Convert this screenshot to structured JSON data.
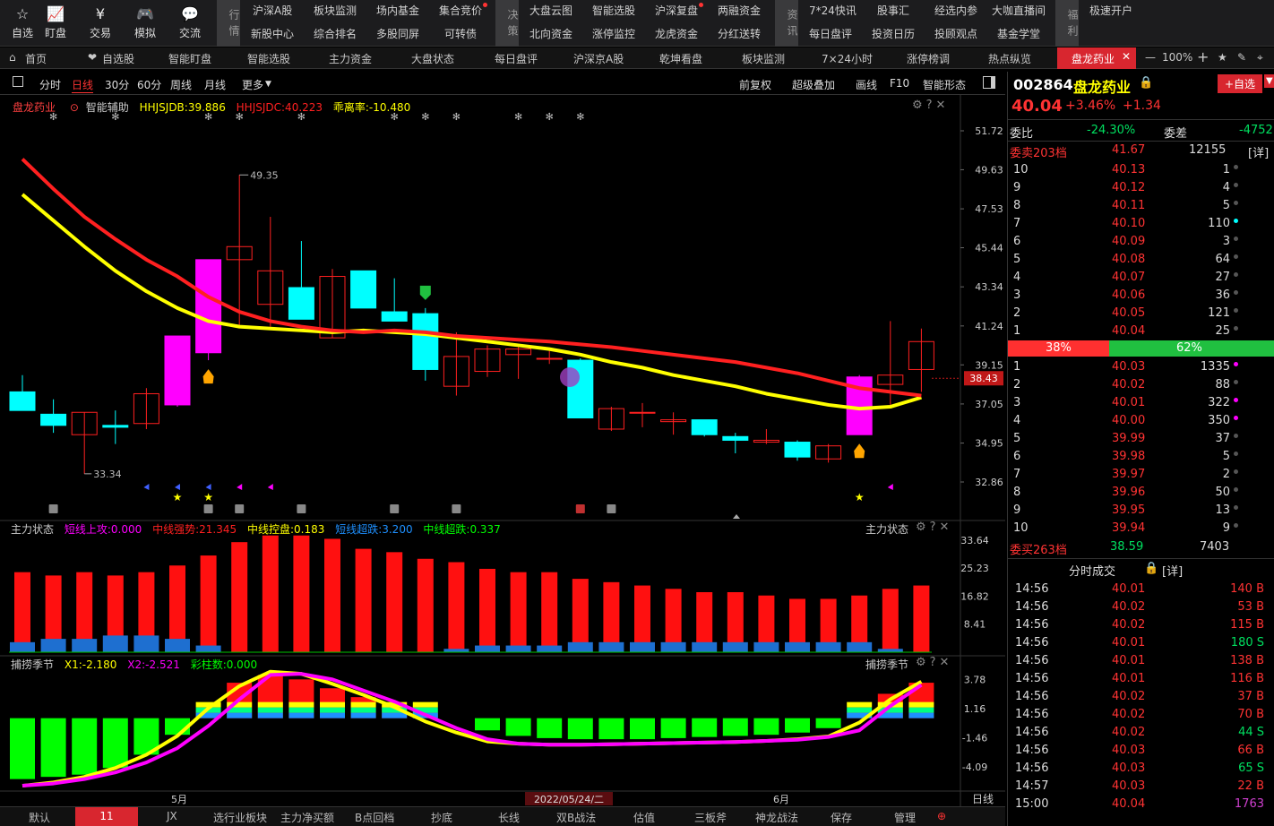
{
  "topbar": {
    "buttons": [
      {
        "label": "自选",
        "icon": "star-icon"
      },
      {
        "label": "盯盘",
        "icon": "chart-icon"
      },
      {
        "label": "交易",
        "icon": "yen-icon"
      },
      {
        "label": "模拟",
        "icon": "gamepad-icon"
      },
      {
        "label": "交流",
        "icon": "chat-icon"
      }
    ],
    "groups": [
      {
        "tab": "行情",
        "items": [
          [
            "沪深A股",
            "新股中心"
          ],
          [
            "板块监测",
            "综合排名"
          ],
          [
            "场内基金",
            "多股同屏"
          ],
          [
            "集合竞价",
            "可转债"
          ]
        ]
      },
      {
        "tab": "决策",
        "items": [
          [
            "大盘云图",
            "北向资金"
          ],
          [
            "智能选股",
            "涨停监控"
          ],
          [
            "沪深复盘",
            "龙虎资金"
          ],
          [
            "两融资金",
            "分红送转"
          ]
        ]
      },
      {
        "tab": "资讯",
        "items": [
          [
            "7*24快讯",
            "每日盘评"
          ],
          [
            "股事汇",
            "投资日历"
          ],
          [
            "经选内参",
            "投顾观点"
          ],
          [
            "大咖直播间",
            "基金学堂"
          ]
        ]
      },
      {
        "tab": "福利",
        "items": [
          [
            "极速开户",
            ""
          ]
        ]
      }
    ]
  },
  "nav": {
    "items": [
      "首页",
      "自选股",
      "智能盯盘",
      "智能选股",
      "主力资金",
      "大盘状态",
      "每日盘评",
      "沪深京A股",
      "乾坤看盘",
      "板块监测",
      "7×24小时",
      "涨停榜调",
      "热点纵览"
    ],
    "active": "盘龙药业",
    "zoom": "100%"
  },
  "period": {
    "items": [
      "分时",
      "日线",
      "30分",
      "60分",
      "周线",
      "月线",
      "更多"
    ],
    "active": "日线",
    "right": [
      "前复权",
      "超级叠加",
      "画线",
      "F10",
      "智能形态"
    ]
  },
  "indicators": {
    "main": {
      "name": "盘龙药业",
      "sub": "智能辅助",
      "v1": "HHJSJDB:39.886",
      "v2": "HHJSJDC:40.223",
      "v3": "乖离率:-10.480"
    },
    "panel2": {
      "name": "主力状态",
      "a": "短线上攻:0.000",
      "b": "中线强势:21.345",
      "c": "中线控盘:0.183",
      "d": "短线超跌:3.200",
      "e": "中线超跌:0.337",
      "title_r": "主力状态"
    },
    "panel3": {
      "name": "捕捞季节",
      "a": "X1:-2.180",
      "b": "X2:-2.521",
      "c": "彩柱数:0.000",
      "title_r": "捕捞季节"
    }
  },
  "chart_data": {
    "type": "candlestick",
    "y_ticks": [
      "51.72",
      "49.63",
      "47.53",
      "45.44",
      "43.34",
      "41.24",
      "39.15",
      "37.05",
      "34.95",
      "32.86"
    ],
    "ylim": [
      32.86,
      51.72
    ],
    "candles": [
      {
        "o": 37.7,
        "c": 36.7,
        "h": 38.6,
        "l": 36.7
      },
      {
        "o": 36.5,
        "c": 35.9,
        "h": 37.3,
        "l": 35.5
      },
      {
        "o": 35.4,
        "c": 36.6,
        "h": 36.6,
        "l": 33.3
      },
      {
        "o": 35.9,
        "c": 35.8,
        "h": 36.7,
        "l": 34.9
      },
      {
        "o": 36.0,
        "c": 37.6,
        "h": 37.9,
        "l": 35.7
      },
      {
        "o": 37.0,
        "c": 40.7,
        "h": 40.7,
        "l": 36.9
      },
      {
        "o": 39.8,
        "c": 44.8,
        "h": 44.8,
        "l": 39.4
      },
      {
        "o": 44.8,
        "c": 45.5,
        "h": 49.35,
        "l": 41.2
      },
      {
        "o": 42.4,
        "c": 44.2,
        "h": 47.1,
        "l": 41.2
      },
      {
        "o": 43.3,
        "c": 41.6,
        "h": 45.8,
        "l": 41.6
      },
      {
        "o": 40.6,
        "c": 43.9,
        "h": 44.3,
        "l": 40.6
      },
      {
        "o": 44.2,
        "c": 42.2,
        "h": 44.2,
        "l": 42.2
      },
      {
        "o": 42.0,
        "c": 41.5,
        "h": 43.8,
        "l": 41.5
      },
      {
        "o": 41.9,
        "c": 38.9,
        "h": 42.2,
        "l": 38.3
      },
      {
        "o": 38.0,
        "c": 39.6,
        "h": 40.9,
        "l": 37.5
      },
      {
        "o": 38.8,
        "c": 40.0,
        "h": 40.2,
        "l": 38.5
      },
      {
        "o": 39.7,
        "c": 40.0,
        "h": 40.1,
        "l": 38.4
      },
      {
        "o": 39.5,
        "c": 39.5,
        "h": 39.9,
        "l": 39.2
      },
      {
        "o": 39.4,
        "c": 36.3,
        "h": 39.5,
        "l": 36.3
      },
      {
        "o": 35.7,
        "c": 36.8,
        "h": 36.9,
        "l": 35.6
      },
      {
        "o": 36.6,
        "c": 36.6,
        "h": 37.1,
        "l": 35.8
      },
      {
        "o": 36.1,
        "c": 36.2,
        "h": 36.6,
        "l": 35.4
      },
      {
        "o": 36.2,
        "c": 35.4,
        "h": 36.2,
        "l": 35.3
      },
      {
        "o": 35.3,
        "c": 35.1,
        "h": 35.5,
        "l": 34.4
      },
      {
        "o": 35.0,
        "c": 35.1,
        "h": 35.7,
        "l": 34.9
      },
      {
        "o": 35.0,
        "c": 34.2,
        "h": 35.1,
        "l": 34.0
      },
      {
        "o": 34.1,
        "c": 34.8,
        "h": 34.9,
        "l": 33.9
      },
      {
        "o": 35.4,
        "c": 38.5,
        "h": 38.6,
        "l": 35.4
      },
      {
        "o": 38.1,
        "c": 38.6,
        "h": 41.5,
        "l": 37.0
      },
      {
        "o": 38.9,
        "c": 40.4,
        "h": 41.1,
        "l": 37.7
      }
    ],
    "hi_label": "49.35",
    "lo_label": "33.34",
    "price_tag": "38.43",
    "ma_red": [
      50.2,
      48.6,
      47.1,
      45.9,
      44.8,
      43.9,
      42.8,
      42.0,
      41.5,
      41.2,
      41.0,
      40.9,
      41.0,
      40.9,
      40.7,
      40.6,
      40.5,
      40.4,
      40.25,
      40.1,
      39.9,
      39.7,
      39.5,
      39.3,
      39.0,
      38.7,
      38.3,
      37.9,
      37.7,
      37.5
    ],
    "ma_yellow": [
      48.3,
      46.9,
      45.5,
      44.2,
      43.1,
      42.2,
      41.5,
      41.2,
      41.1,
      41.0,
      40.9,
      41.0,
      40.9,
      40.8,
      40.6,
      40.4,
      40.2,
      40.0,
      39.7,
      39.3,
      39.0,
      38.6,
      38.3,
      38.0,
      37.6,
      37.3,
      37.0,
      36.8,
      36.9,
      37.4
    ],
    "p2_ticks": [
      "33.64",
      "25.23",
      "16.82",
      "8.41"
    ],
    "p2_red": [
      24,
      23,
      24,
      23,
      24,
      26,
      29,
      33,
      35,
      35,
      34,
      31,
      30,
      28,
      27,
      25,
      24,
      24,
      22,
      21,
      20,
      19,
      18,
      18,
      17,
      16,
      16,
      17,
      19,
      20,
      21
    ],
    "p2_blue": [
      3,
      4,
      4,
      5,
      5,
      4,
      2,
      0,
      0,
      0,
      0,
      0,
      0,
      0,
      1,
      2,
      2,
      2,
      3,
      3,
      3,
      3,
      3,
      3,
      3,
      3,
      3,
      3,
      1,
      0,
      0
    ],
    "p3_ticks": [
      "3.78",
      "1.16",
      "-1.46",
      "-4.09"
    ],
    "p3_bars": [
      -5.2,
      -5.0,
      -4.8,
      -4.2,
      -3.0,
      -1.2,
      1.0,
      3.5,
      4.2,
      3.8,
      3.0,
      2.2,
      1.5,
      0.8,
      0,
      -0.8,
      -1.3,
      -1.5,
      -1.6,
      -1.6,
      -1.6,
      -1.5,
      -1.4,
      -1.3,
      -1.2,
      -1.0,
      -0.6,
      0.8,
      2.5,
      3.5
    ],
    "p3_x1": [
      -5.8,
      -5.5,
      -5.0,
      -4.2,
      -3.0,
      -1.3,
      1.2,
      3.2,
      4.5,
      4.3,
      3.4,
      2.4,
      1.3,
      0.0,
      -1.0,
      -1.8,
      -2.0,
      -2.1,
      -2.1,
      -2.05,
      -2.0,
      -1.95,
      -1.9,
      -1.85,
      -1.75,
      -1.6,
      -1.35,
      -0.1,
      2.0,
      3.6
    ],
    "p3_x2": [
      -5.8,
      -5.6,
      -5.2,
      -4.6,
      -3.7,
      -2.4,
      -0.4,
      2.0,
      4.2,
      4.3,
      3.8,
      2.8,
      1.8,
      0.6,
      -0.6,
      -1.6,
      -2.0,
      -2.1,
      -2.1,
      -2.05,
      -2.0,
      -1.95,
      -1.9,
      -1.85,
      -1.75,
      -1.65,
      -1.4,
      -0.8,
      1.4,
      3.3
    ],
    "x_labels": [
      "5月",
      "2022/05/24/二",
      "6月",
      "日线"
    ]
  },
  "quote": {
    "code": "002864",
    "name": "盘龙药业",
    "price": "40.04",
    "pct": "+3.46%",
    "chg": "+1.34",
    "add": "+自选",
    "wb": "委比",
    "wb_v": "-24.30%",
    "wc": "委差",
    "wc_v": "-4752",
    "sell_hdr": "委卖203档",
    "sell_hdr_p": "41.67",
    "sell_hdr_v": "12155",
    "detail": "[详]",
    "asks": [
      [
        "10",
        "40.13",
        "1"
      ],
      [
        "9",
        "40.12",
        "4"
      ],
      [
        "8",
        "40.11",
        "5"
      ],
      [
        "7",
        "40.10",
        "110"
      ],
      [
        "6",
        "40.09",
        "3"
      ],
      [
        "5",
        "40.08",
        "64"
      ],
      [
        "4",
        "40.07",
        "27"
      ],
      [
        "3",
        "40.06",
        "36"
      ],
      [
        "2",
        "40.05",
        "121"
      ],
      [
        "1",
        "40.04",
        "25"
      ]
    ],
    "ratio_l": "38%",
    "ratio_r": "62%",
    "bids": [
      [
        "1",
        "40.03",
        "1335"
      ],
      [
        "2",
        "40.02",
        "88"
      ],
      [
        "3",
        "40.01",
        "322"
      ],
      [
        "4",
        "40.00",
        "350"
      ],
      [
        "5",
        "39.99",
        "37"
      ],
      [
        "6",
        "39.98",
        "5"
      ],
      [
        "7",
        "39.97",
        "2"
      ],
      [
        "8",
        "39.96",
        "50"
      ],
      [
        "9",
        "39.95",
        "13"
      ],
      [
        "10",
        "39.94",
        "9"
      ]
    ],
    "buy_hdr": "委买263档",
    "buy_hdr_p": "38.59",
    "buy_hdr_v": "7403",
    "trade_title": "分时成交",
    "trade_detail": "[详]",
    "trades": [
      [
        "14:56",
        "40.01",
        "140 B"
      ],
      [
        "14:56",
        "40.02",
        "53 B"
      ],
      [
        "14:56",
        "40.02",
        "115 B"
      ],
      [
        "14:56",
        "40.01",
        "180 S"
      ],
      [
        "14:56",
        "40.01",
        "138 B"
      ],
      [
        "14:56",
        "40.01",
        "116 B"
      ],
      [
        "14:56",
        "40.02",
        "37 B"
      ],
      [
        "14:56",
        "40.02",
        "70 B"
      ],
      [
        "14:56",
        "40.02",
        "44 S"
      ],
      [
        "14:56",
        "40.03",
        "66 B"
      ],
      [
        "14:56",
        "40.03",
        "65 S"
      ],
      [
        "14:57",
        "40.03",
        "22 B"
      ],
      [
        "15:00",
        "40.04",
        "1763"
      ]
    ]
  },
  "bottom": {
    "items": [
      "默认",
      "11",
      "JX",
      "选行业板块",
      "主力净买额",
      "B点回档",
      "抄底",
      "长线",
      "双B战法",
      "估值",
      "三板斧",
      "神龙战法",
      "保存",
      "管理"
    ]
  },
  "colors": {
    "up": "#ff2020",
    "down": "#00ffff",
    "magenta": "#ff00ff",
    "yellow": "#ffff00",
    "green": "#00ff00",
    "accent": "#d8262f"
  }
}
